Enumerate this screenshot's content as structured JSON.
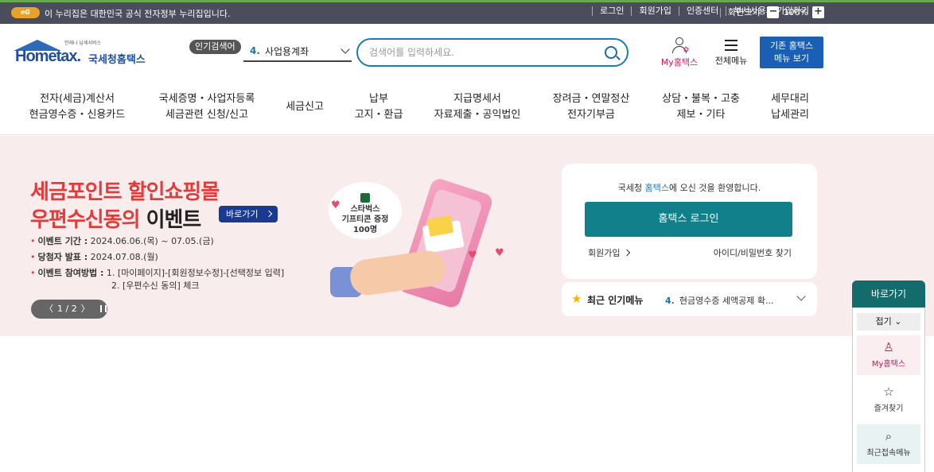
{
  "topbar": {
    "gov_logo": "eG",
    "gov_notice": "이 누리집은 대한민국 공식 전자정부 누리집입니다.",
    "links": [
      "로그인",
      "회원가입",
      "인증센터",
      "부서사용자 가입하기"
    ],
    "zoom_label": "화면크기",
    "zoom_minus": "−",
    "zoom_value": "100%",
    "zoom_plus": "+"
  },
  "header": {
    "logo_text": "Hometax.",
    "logo_name": "국세청홈택스",
    "logo_tagline": "언제나 납세서비스",
    "popular_label": "인기검색어",
    "popular_num": "4.",
    "popular_keyword": "사업용계좌",
    "search_placeholder": "검색어를 입력하세요.",
    "my_hometax": "My홈택스",
    "all_menu": "전체메뉴",
    "legacy_line1": "기존 홈택스",
    "legacy_line2": "메뉴 보기"
  },
  "gnb": [
    {
      "l1": "전자(세금)계산서",
      "l2": "현금영수증・신용카드"
    },
    {
      "l1": "국세증명・사업자등록",
      "l2": "세금관련 신청/신고"
    },
    {
      "l1": "세금신고",
      "l2": ""
    },
    {
      "l1": "납부",
      "l2": "고지・환급"
    },
    {
      "l1": "지급명세서",
      "l2": "자료제출・공익법인"
    },
    {
      "l1": "장려금・연말정산",
      "l2": "전자기부금"
    },
    {
      "l1": "상담・불복・고충",
      "l2": "제보・기타"
    },
    {
      "l1": "세무대리",
      "l2": "납세관리"
    }
  ],
  "event": {
    "title1": "세금포인트 할인쇼핑몰",
    "title2_red": "우편수신동의",
    "title2_dark": " 이벤트",
    "go_button": "바로가기",
    "period_label": "이벤트 기간 :",
    "period_value": "2024.06.06.(목) ~ 07.05.(금)",
    "winner_label": "당첨자 발표 :",
    "winner_value": "2024.07.08.(월)",
    "method_label": "이벤트 참여방법 :",
    "method_1": "1. [마이페이지]-[회원정보수정]-[선택정보 입력]",
    "method_2": "2. [우편수신 동의] 체크",
    "bubble_line1": "스타벅스",
    "bubble_line2": "기프티콘 증정",
    "bubble_line3": "100명",
    "slide_prev": "〈",
    "slide_counter": "1 / 2",
    "slide_next": "〉"
  },
  "login": {
    "welcome_pre": "국세청 ",
    "welcome_hl": "홈택스",
    "welcome_post": "에 오신 것을 환영합니다.",
    "login_button": "홈택스 로그인",
    "join_link": "회원가입",
    "find_link": "아이디/비밀번호 찾기"
  },
  "recent": {
    "label": "최근 인기메뉴",
    "num": "4.",
    "item": "현금영수증 세액공제 확..."
  },
  "quick": {
    "title": "바로가기",
    "fold": "접기",
    "items": [
      "My홈택스",
      "즐겨찾기",
      "최근접속메뉴"
    ]
  },
  "colors": {
    "accent_teal": "#11808a",
    "brand_blue": "#1a5fb4",
    "event_red": "#e23b3b",
    "topbar": "#4a4d5b"
  }
}
